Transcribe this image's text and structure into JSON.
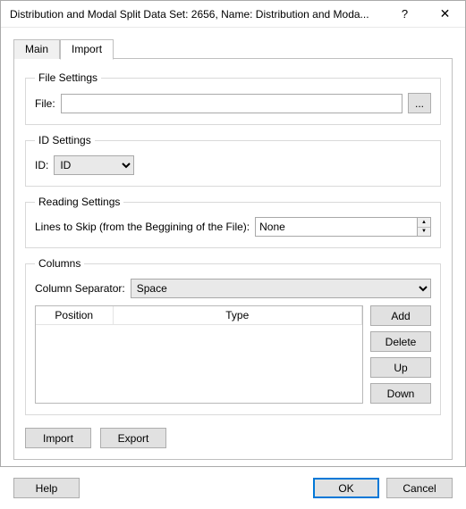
{
  "title": "Distribution and Modal Split Data Set: 2656, Name: Distribution and Moda...",
  "titlebar": {
    "help_glyph": "?",
    "close_glyph": "✕"
  },
  "tabs": {
    "main": "Main",
    "import": "Import"
  },
  "file_settings": {
    "legend": "File Settings",
    "file_label": "File:",
    "file_value": "",
    "browse_glyph": "..."
  },
  "id_settings": {
    "legend": "ID Settings",
    "id_label": "ID:",
    "id_value": "ID",
    "options": [
      "ID"
    ]
  },
  "reading_settings": {
    "legend": "Reading Settings",
    "lines_label": "Lines to Skip (from the Beggining of the File):",
    "lines_value": "None"
  },
  "columns": {
    "legend": "Columns",
    "sep_label": "Column Separator:",
    "sep_value": "Space",
    "sep_options": [
      "Space"
    ],
    "headers": {
      "position": "Position",
      "type": "Type"
    },
    "rows": [],
    "buttons": {
      "add": "Add",
      "delete": "Delete",
      "up": "Up",
      "down": "Down"
    }
  },
  "actions": {
    "import": "Import",
    "export": "Export"
  },
  "footer": {
    "help": "Help",
    "ok": "OK",
    "cancel": "Cancel"
  }
}
